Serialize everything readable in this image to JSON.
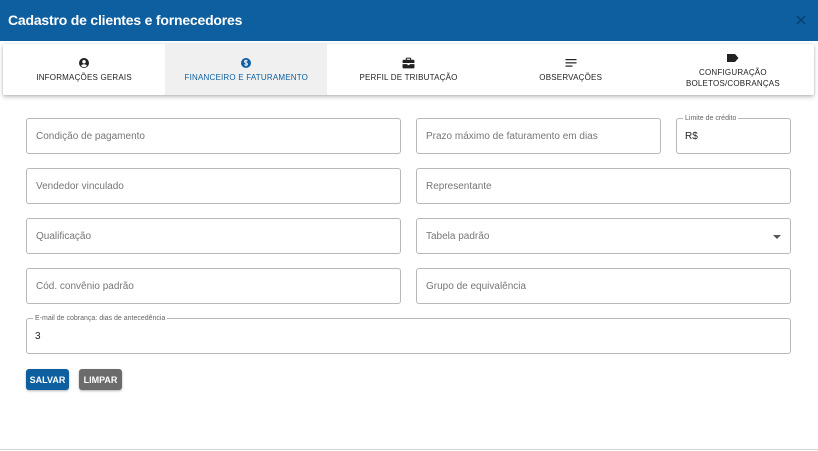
{
  "dialog": {
    "title": "Cadastro de clientes e fornecedores",
    "close_icon": "close-icon"
  },
  "tabs": [
    {
      "label": "INFORMAÇÕES GERAIS",
      "icon": "account-circle-icon",
      "active": false
    },
    {
      "label": "FINANCEIRO E FATURAMENTO",
      "icon": "dollar-circle-icon",
      "active": true
    },
    {
      "label": "PERFIL DE TRIBUTAÇÃO",
      "icon": "briefcase-icon",
      "active": false
    },
    {
      "label": "OBSERVAÇÕES",
      "icon": "notes-icon",
      "active": false
    },
    {
      "label_line1": "CONFIGURAÇÃO",
      "label_line2": "BOLETOS/COBRANÇAS",
      "icon": "label-tag-icon",
      "active": false
    }
  ],
  "form": {
    "payment_condition": {
      "placeholder": "Condição de pagamento",
      "value": ""
    },
    "max_billing_days": {
      "placeholder": "Prazo máximo de faturamento em dias",
      "value": ""
    },
    "credit_limit": {
      "label": "Limite de crédito",
      "prefix": "R$",
      "value": ""
    },
    "linked_seller": {
      "placeholder": "Vendedor vinculado",
      "value": ""
    },
    "representative": {
      "placeholder": "Representante",
      "value": ""
    },
    "qualification": {
      "placeholder": "Qualificação",
      "value": ""
    },
    "default_table": {
      "placeholder": "Tabela padrão",
      "value": ""
    },
    "default_agreement_code": {
      "placeholder": "Cód. convênio padrão",
      "value": ""
    },
    "equivalence_group": {
      "placeholder": "Grupo de equivalência",
      "value": ""
    },
    "billing_email_days": {
      "label": "E-mail de cobrança: dias de antecedência",
      "value": "3"
    }
  },
  "actions": {
    "save_label": "SALVAR",
    "clear_label": "LIMPAR"
  },
  "colors": {
    "primary": "#0d5f9f",
    "secondary_button": "#6b6b6b"
  }
}
